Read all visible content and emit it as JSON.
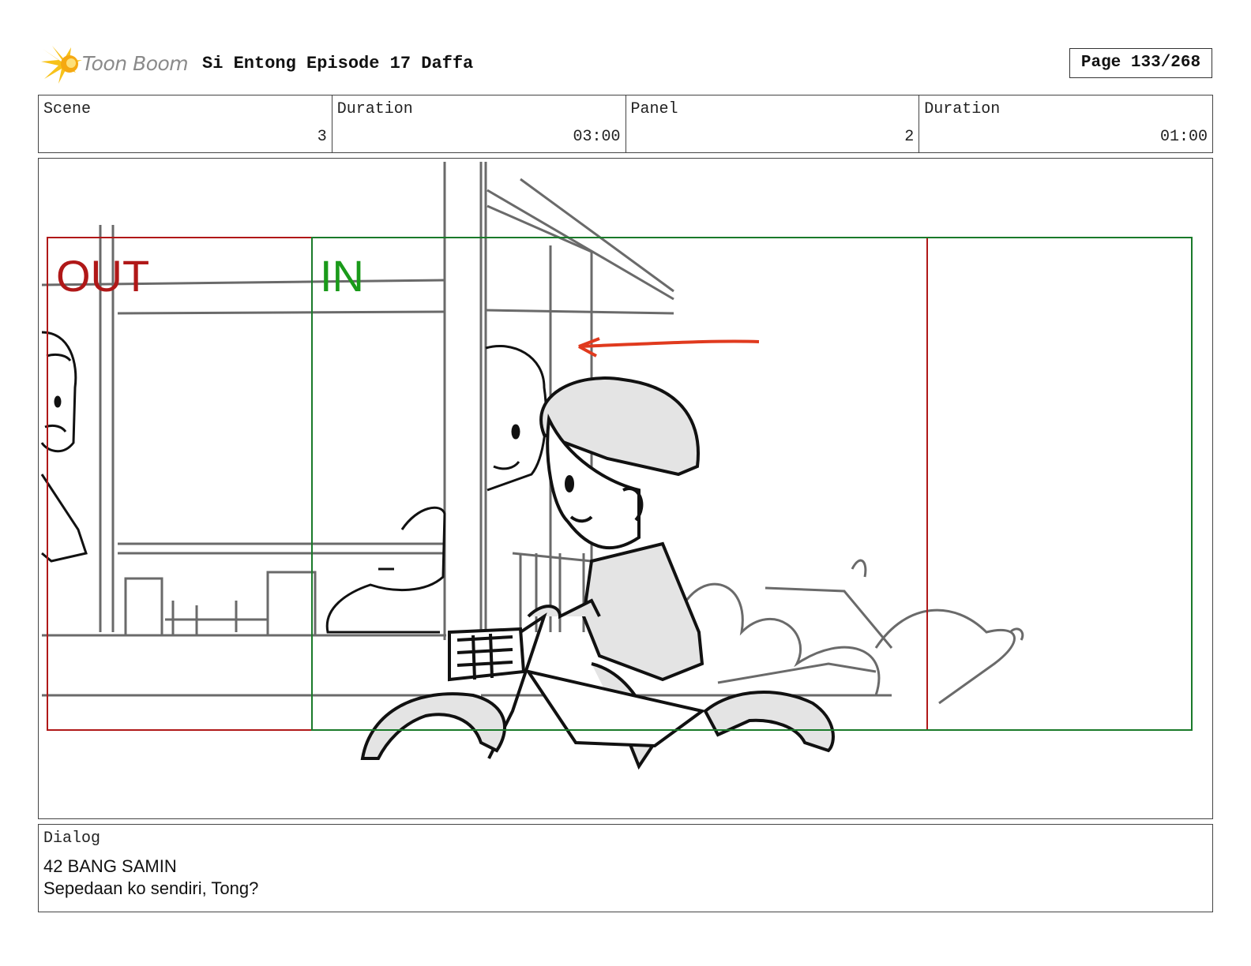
{
  "header": {
    "logo_text": "Toon Boom",
    "title": "Si Entong Episode 17 Daffa",
    "page_label": "Page 133/268"
  },
  "info": {
    "scene_label": "Scene",
    "scene_value": "3",
    "scene_duration_label": "Duration",
    "scene_duration_value": "03:00",
    "panel_label": "Panel",
    "panel_value": "2",
    "panel_duration_label": "Duration",
    "panel_duration_value": "01:00"
  },
  "frame": {
    "out_label": "OUT",
    "in_label": "IN",
    "out_color": "#b01818",
    "in_color": "#1a9a1a",
    "arrow_color": "#e03a1e"
  },
  "dialog": {
    "label": "Dialog",
    "character": "42 BANG SAMIN",
    "line": "Sepedaan ko sendiri, Tong?"
  }
}
